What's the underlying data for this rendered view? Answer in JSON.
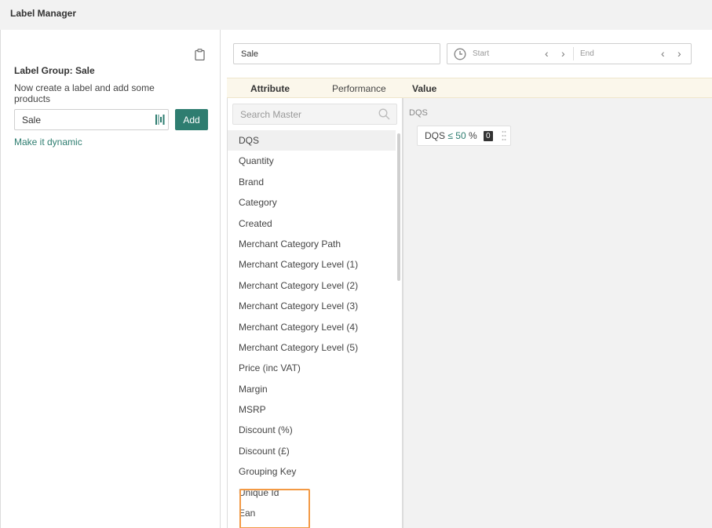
{
  "window": {
    "title": "Label Manager"
  },
  "left_panel": {
    "clipboard_icon": "clipboard-icon",
    "group_title": "Label Group: Sale",
    "instructions": "Now create a label and add some products",
    "label_input_value": "Sale",
    "barcode_icon": "barcode-icon",
    "add_label": "Add",
    "dynamic_link": "Make it dynamic"
  },
  "search": {
    "value": "Sale"
  },
  "date_range": {
    "clock_icon": "clock-icon",
    "start_placeholder": "Start",
    "end_placeholder": "End",
    "prev_arrow": "‹",
    "next_arrow": "›"
  },
  "tabs": [
    {
      "label": "Attribute"
    },
    {
      "label": "Performance"
    },
    {
      "label": "Value"
    }
  ],
  "attributes": {
    "search_placeholder": "Search Master",
    "items": [
      "DQS",
      "Quantity",
      "Brand",
      "Category",
      "Created",
      "Merchant Category Path",
      "Merchant Category Level (1)",
      "Merchant Category Level (2)",
      "Merchant Category Level (3)",
      "Merchant Category Level (4)",
      "Merchant Category Level (5)",
      "Price (inc VAT)",
      "Margin",
      "MSRP",
      "Discount (%)",
      "Discount (£)",
      "Grouping Key",
      "Unique Id",
      "Ean"
    ],
    "selected": "DQS",
    "highlighted": [
      "Discount (%)",
      "Discount (£)"
    ]
  },
  "value_panel": {
    "section_label": "DQS",
    "condition": {
      "field": "DQS",
      "operator": "≤",
      "value": "50",
      "unit": "%",
      "badge": "0"
    }
  },
  "colors": {
    "accent": "#2e7d70",
    "highlight": "#f39a45",
    "tabbar": "#fbf7eb"
  }
}
